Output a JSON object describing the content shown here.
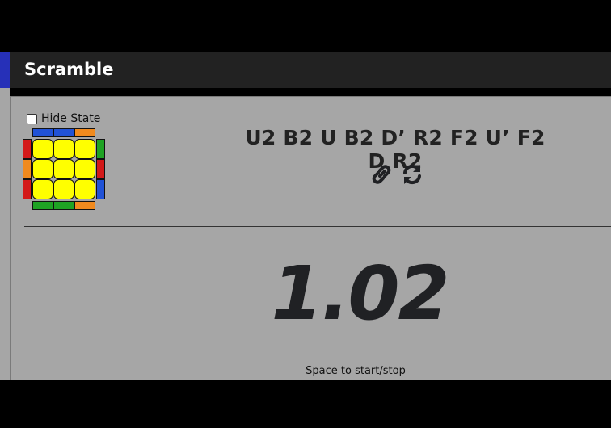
{
  "header": {
    "title": "Scramble"
  },
  "hide_state": {
    "label": "Hide State",
    "checked": false
  },
  "scramble": {
    "text": "U2 B2 U B2 D’ R2 F2 U’ F2 D R2"
  },
  "icons": {
    "link": "link-icon",
    "refresh": "refresh-icon"
  },
  "timer": {
    "value": "1.02"
  },
  "hint": "Space to start/stop",
  "cube_colors": {
    "top_row": [
      "#2152d6",
      "#2152d6",
      "#f08a1e"
    ],
    "left_col": [
      "#d31919",
      "#f08a1e",
      "#d31919"
    ],
    "right_col": [
      "#1fa324",
      "#d31919",
      "#2152d6"
    ],
    "bottom_row": [
      "#1fa324",
      "#1fa324",
      "#f08a1e"
    ],
    "face": "#ffff00"
  }
}
